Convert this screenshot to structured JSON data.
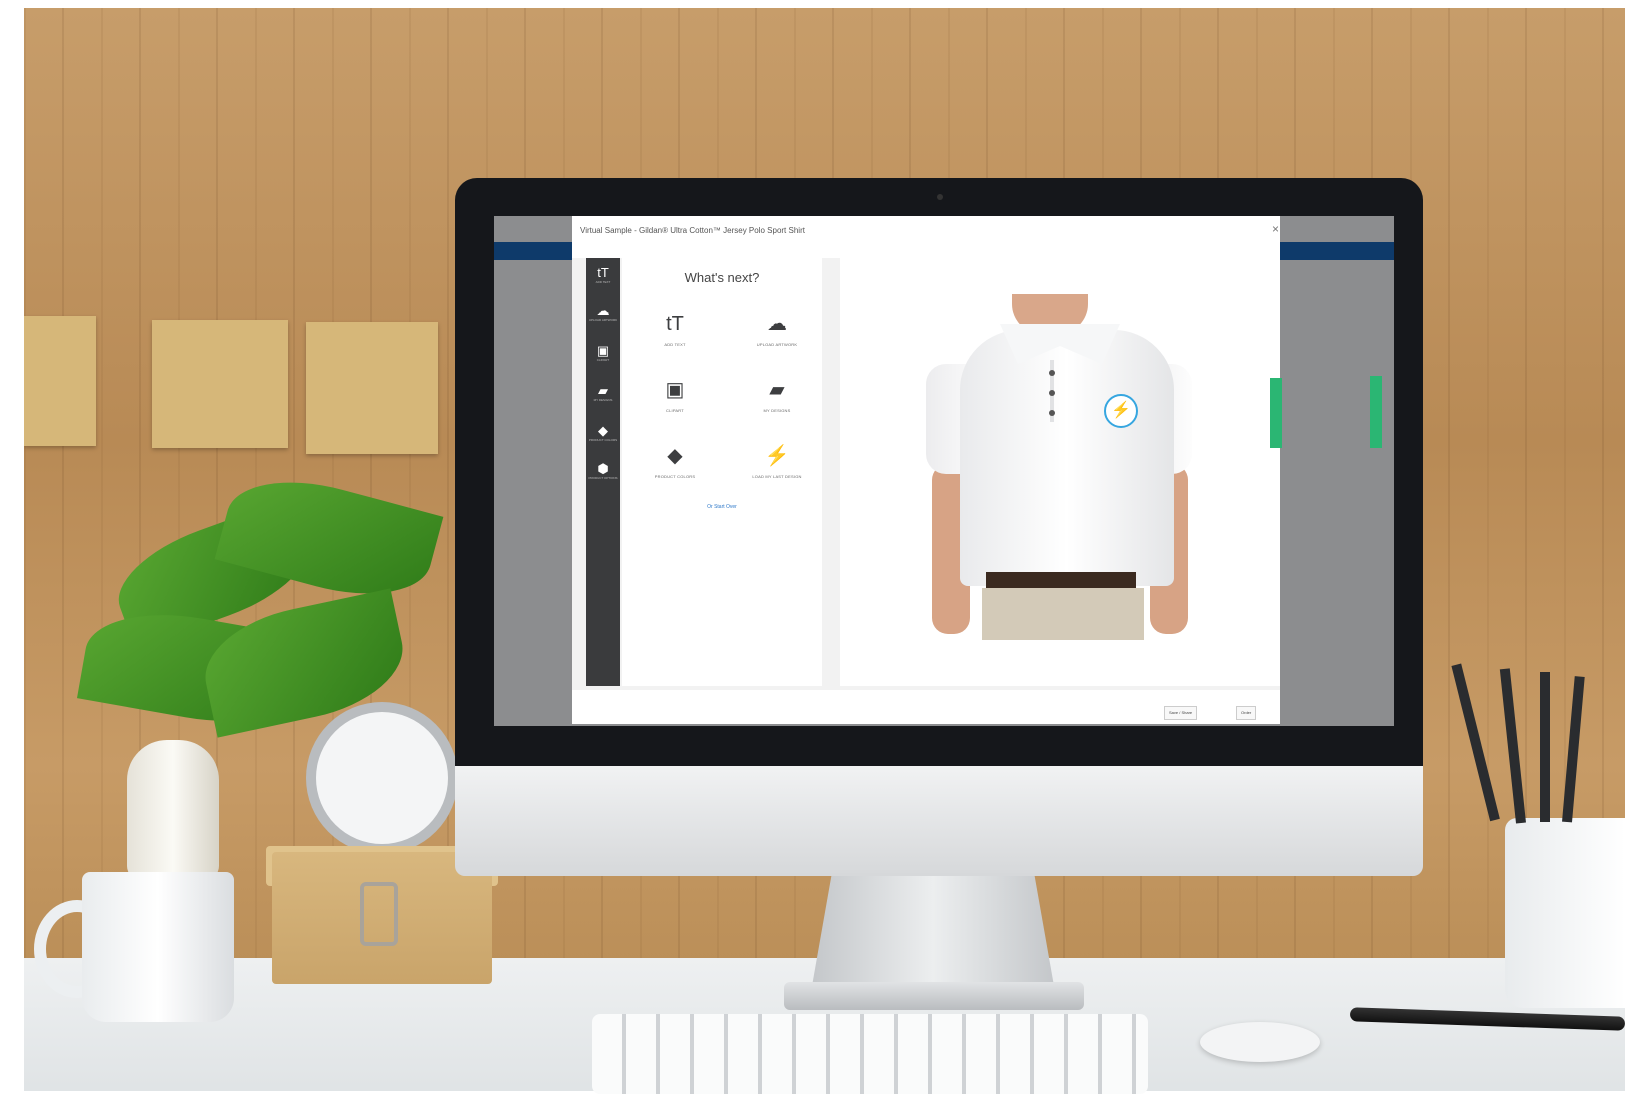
{
  "modal": {
    "title": "Virtual Sample - Gildan® Ultra Cotton™ Jersey Polo Sport Shirt",
    "close": "×"
  },
  "sidebar": {
    "items": [
      {
        "icon": "tT",
        "label": "ADD TEXT"
      },
      {
        "icon": "☁",
        "label": "UPLOAD ARTWORK"
      },
      {
        "icon": "▣",
        "label": "CLIPART"
      },
      {
        "icon": "▰",
        "label": "MY DESIGNS"
      },
      {
        "icon": "◆",
        "label": "PRODUCT COLORS"
      },
      {
        "icon": "⬢",
        "label": "PRODUCT OPTIONS"
      }
    ]
  },
  "panel": {
    "heading": "What's next?",
    "options": [
      {
        "icon": "tT",
        "label": "ADD TEXT"
      },
      {
        "icon": "☁",
        "label": "UPLOAD ARTWORK"
      },
      {
        "icon": "▣",
        "label": "CLIPART"
      },
      {
        "icon": "▰",
        "label": "MY DESIGNS"
      },
      {
        "icon": "◆",
        "label": "PRODUCT COLORS"
      },
      {
        "icon": "⚡",
        "label": "LOAD MY LAST DESIGN"
      }
    ],
    "start_over": "Or Start Over"
  },
  "preview": {
    "logo_icon": "⚡"
  },
  "footer": {
    "save_label": "Save / Share",
    "order_label": "Order"
  },
  "colors": {
    "toolbar": "#3a3b3d",
    "nav_stripe": "#0e3a6a",
    "side_tab": "#2bb673",
    "link": "#2f79c9",
    "logo_accent": "#36a6e0"
  }
}
